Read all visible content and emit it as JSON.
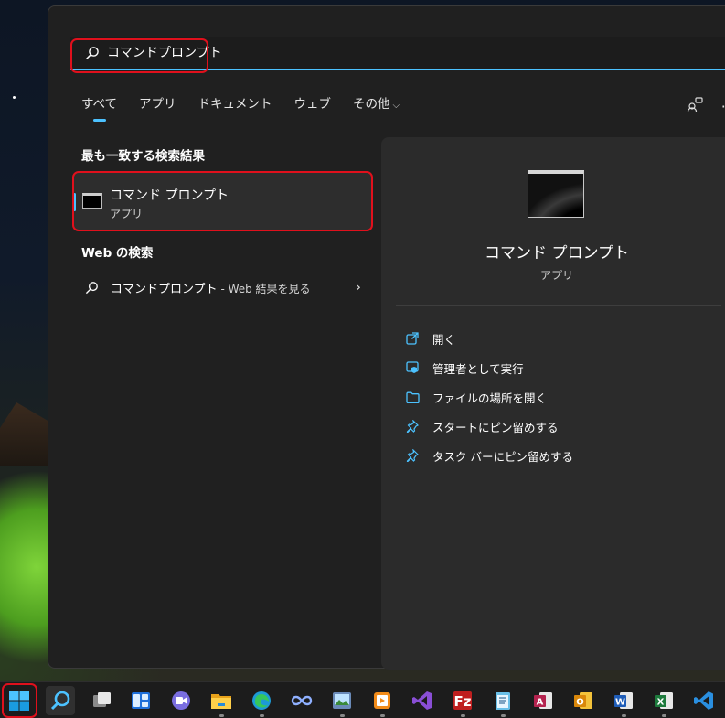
{
  "search": {
    "query": "コマンドプロンプト"
  },
  "tabs": [
    {
      "label": "すべて"
    },
    {
      "label": "アプリ"
    },
    {
      "label": "ドキュメント"
    },
    {
      "label": "ウェブ"
    },
    {
      "label": "その他"
    }
  ],
  "header_more": "···",
  "best_match": {
    "heading": "最も一致する検索結果",
    "title": "コマンド プロンプト",
    "subtitle": "アプリ"
  },
  "web_search": {
    "heading": "Web の検索",
    "query": "コマンドプロンプト",
    "suffix": " - Web 結果を見る",
    "arrow": "›"
  },
  "preview": {
    "title": "コマンド プロンプト",
    "subtitle": "アプリ",
    "actions": [
      {
        "label": "開く",
        "icon": "open-icon"
      },
      {
        "label": "管理者として実行",
        "icon": "run-as-admin-icon"
      },
      {
        "label": "ファイルの場所を開く",
        "icon": "folder-icon"
      },
      {
        "label": "スタートにピン留めする",
        "icon": "pin-icon"
      },
      {
        "label": "タスク バーにピン留めする",
        "icon": "pin-icon"
      }
    ]
  },
  "colors": {
    "accent": "#4cc2ff",
    "highlight": "#e0101c",
    "panel": "#202020",
    "preview": "#2b2b2b"
  },
  "taskbar": {
    "icons": [
      "windows-start-icon",
      "search-icon",
      "task-view-icon",
      "widgets-icon",
      "teams-chat-icon",
      "file-explorer-icon",
      "edge-icon",
      "infinity-app-icon",
      "photos-app-icon",
      "media-player-icon",
      "visual-studio-icon",
      "filezilla-icon",
      "notepad-icon",
      "access-icon",
      "outlook-icon",
      "word-icon",
      "excel-icon",
      "vscode-icon"
    ]
  }
}
